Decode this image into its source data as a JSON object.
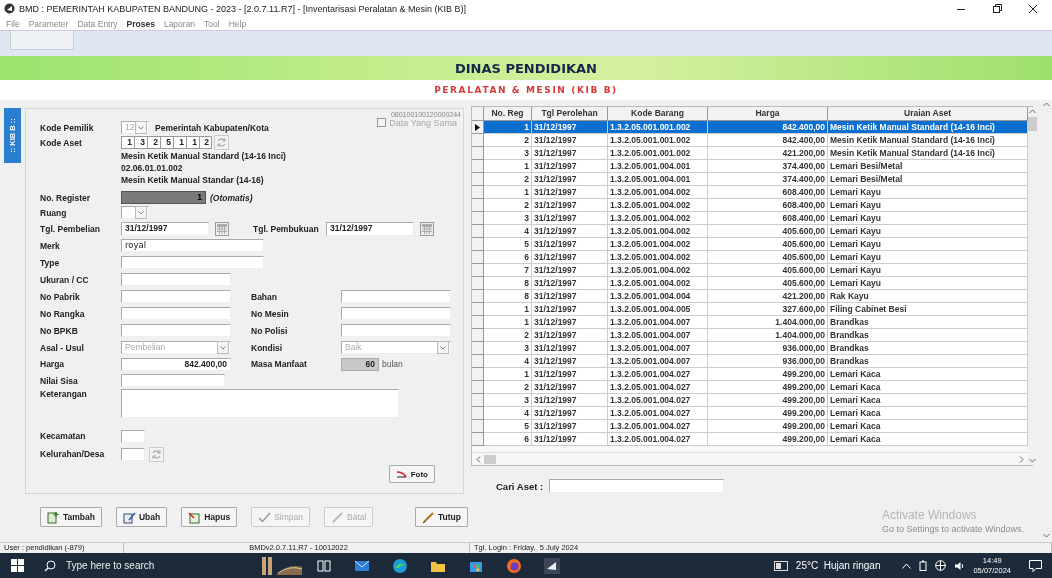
{
  "window": {
    "title": "BMD : PEMERINTAH KABUPATEN BANDUNG - 2023 - [2.0.7.11.R7] - [Inventarisasi Peralatan & Mesin (KIB B)]"
  },
  "menu": [
    {
      "label": "File",
      "highlighted": false
    },
    {
      "label": "Parameter",
      "highlighted": false
    },
    {
      "label": "Data Entry",
      "highlighted": false
    },
    {
      "label": "Proses",
      "highlighted": true
    },
    {
      "label": "Laporan",
      "highlighted": false
    },
    {
      "label": "Tool",
      "highlighted": false
    },
    {
      "label": "Help",
      "highlighted": false
    }
  ],
  "header": {
    "title": "DINAS PENDIDIKAN",
    "subtitle": "PERALATAN & MESIN (KIB B)"
  },
  "side_tab": ":: KIB B ::",
  "form": {
    "record_code": "080100100120000244",
    "same_data": {
      "label": "Data Yang Sama",
      "checked": false,
      "disabled": true
    },
    "owner": {
      "label": "Kode Pemilik",
      "code": "12",
      "name": "Pemerintah Kabupaten/Kota"
    },
    "asset_code": {
      "label": "Kode Aset",
      "segments": [
        "1",
        "3",
        "2",
        "5",
        "1",
        "1",
        "2"
      ],
      "description": [
        "Mesin Ketik Manual Standard (14-16 Inci)",
        "02.06.01.01.002",
        "Mesin Ketik Manual Standar (14-16)"
      ]
    },
    "register": {
      "label": "No. Register",
      "value": "1",
      "note": "(Otomatis)"
    },
    "room": {
      "label": "Ruang"
    },
    "purchase_date": {
      "label": "Tgl. Pembelian",
      "value": "31/12/1997"
    },
    "booking_date": {
      "label": "Tgl. Pembukuan",
      "value": "31/12/1997"
    },
    "merk": {
      "label": "Merk",
      "value": "royal"
    },
    "type": {
      "label": "Type"
    },
    "size": {
      "label": "Ukuran / CC"
    },
    "pairs": [
      {
        "left": "No Pabrik",
        "right": "Bahan"
      },
      {
        "left": "No Rangka",
        "right": "No Mesin"
      },
      {
        "left": "No BPKB",
        "right": "No Polisi"
      }
    ],
    "origin": {
      "label": "Asal - Usul",
      "value": "Pembelian"
    },
    "condition": {
      "label": "Kondisi",
      "value": "Baik"
    },
    "price": {
      "label": "Harga",
      "value": "842.400,00"
    },
    "useful_life": {
      "label": "Masa Manfaat",
      "value": "60",
      "unit": "bulan"
    },
    "residual": {
      "label": "Nilai Sisa"
    },
    "notes": {
      "label": "Keterangan"
    },
    "district": {
      "label": "Kecamatan"
    },
    "village": {
      "label": "Kelurahan/Desa"
    },
    "photo_button": "Foto"
  },
  "buttons": [
    {
      "label": "Tambah",
      "disabled": false
    },
    {
      "label": "Ubah",
      "disabled": false
    },
    {
      "label": "Hapus",
      "disabled": false
    },
    {
      "label": "Simpan",
      "disabled": true
    },
    {
      "label": "Batal",
      "disabled": true
    },
    {
      "label": "Tutup",
      "disabled": false
    }
  ],
  "table": {
    "columns": [
      "No. Reg",
      "Tgl Perolehan",
      "Kode Barang",
      "Harga",
      "Uraian Aset"
    ],
    "rows": [
      {
        "cells": [
          "1",
          "31/12/1997",
          "1.3.2.05.001.001.002",
          "842.400,00",
          "Mesin Ketik Manual Standard (14-16 Inci)"
        ],
        "selected": true
      },
      {
        "cells": [
          "2",
          "31/12/1997",
          "1.3.2.05.001.001.002",
          "842.400,00",
          "Mesin Ketik Manual Standard (14-16 Inci)"
        ],
        "selected": false
      },
      {
        "cells": [
          "3",
          "31/12/1997",
          "1.3.2.05.001.001.002",
          "421.200,00",
          "Mesin Ketik Manual Standard (14-16 Inci)"
        ],
        "selected": false
      },
      {
        "cells": [
          "1",
          "31/12/1997",
          "1.3.2.05.001.004.001",
          "374.400,00",
          "Lemari Besi/Metal"
        ],
        "selected": false
      },
      {
        "cells": [
          "2",
          "31/12/1997",
          "1.3.2.05.001.004.001",
          "374.400,00",
          "Lemari Besi/Metal"
        ],
        "selected": false
      },
      {
        "cells": [
          "1",
          "31/12/1997",
          "1.3.2.05.001.004.002",
          "608.400,00",
          "Lemari Kayu"
        ],
        "selected": false
      },
      {
        "cells": [
          "2",
          "31/12/1997",
          "1.3.2.05.001.004.002",
          "608.400,00",
          "Lemari Kayu"
        ],
        "selected": false
      },
      {
        "cells": [
          "3",
          "31/12/1997",
          "1.3.2.05.001.004.002",
          "608.400,00",
          "Lemari Kayu"
        ],
        "selected": false
      },
      {
        "cells": [
          "4",
          "31/12/1997",
          "1.3.2.05.001.004.002",
          "405.600,00",
          "Lemari Kayu"
        ],
        "selected": false
      },
      {
        "cells": [
          "5",
          "31/12/1997",
          "1.3.2.05.001.004.002",
          "405.600,00",
          "Lemari Kayu"
        ],
        "selected": false
      },
      {
        "cells": [
          "6",
          "31/12/1997",
          "1.3.2.05.001.004.002",
          "405.600,00",
          "Lemari Kayu"
        ],
        "selected": false
      },
      {
        "cells": [
          "7",
          "31/12/1997",
          "1.3.2.05.001.004.002",
          "405.600,00",
          "Lemari Kayu"
        ],
        "selected": false
      },
      {
        "cells": [
          "8",
          "31/12/1997",
          "1.3.2.05.001.004.002",
          "405.600,00",
          "Lemari Kayu"
        ],
        "selected": false
      },
      {
        "cells": [
          "8",
          "31/12/1997",
          "1.3.2.05.001.004.004",
          "421.200,00",
          "Rak Kayu"
        ],
        "selected": false
      },
      {
        "cells": [
          "1",
          "31/12/1997",
          "1.3.2.05.001.004.005",
          "327.600,00",
          "Filing Cabinet Besi"
        ],
        "selected": false
      },
      {
        "cells": [
          "1",
          "31/12/1997",
          "1.3.2.05.001.004.007",
          "1.404.000,00",
          "Brandkas"
        ],
        "selected": false
      },
      {
        "cells": [
          "2",
          "31/12/1997",
          "1.3.2.05.001.004.007",
          "1.404.000,00",
          "Brandkas"
        ],
        "selected": false
      },
      {
        "cells": [
          "3",
          "31/12/1997",
          "1.3.2.05.001.004.007",
          "936.000,00",
          "Brandkas"
        ],
        "selected": false
      },
      {
        "cells": [
          "4",
          "31/12/1997",
          "1.3.2.05.001.004.007",
          "936.000,00",
          "Brandkas"
        ],
        "selected": false
      },
      {
        "cells": [
          "1",
          "31/12/1997",
          "1.3.2.05.001.004.027",
          "499.200,00",
          "Lemari Kaca"
        ],
        "selected": false
      },
      {
        "cells": [
          "2",
          "31/12/1997",
          "1.3.2.05.001.004.027",
          "499.200,00",
          "Lemari Kaca"
        ],
        "selected": false
      },
      {
        "cells": [
          "3",
          "31/12/1997",
          "1.3.2.05.001.004.027",
          "499.200,00",
          "Lemari Kaca"
        ],
        "selected": false
      },
      {
        "cells": [
          "4",
          "31/12/1997",
          "1.3.2.05.001.004.027",
          "499.200,00",
          "Lemari Kaca"
        ],
        "selected": false
      },
      {
        "cells": [
          "5",
          "31/12/1997",
          "1.3.2.05.001.004.027",
          "499.200,00",
          "Lemari Kaca"
        ],
        "selected": false
      },
      {
        "cells": [
          "6",
          "31/12/1997",
          "1.3.2.05.001.004.027",
          "499.200,00",
          "Lemari Kaca"
        ],
        "selected": false
      }
    ]
  },
  "search": {
    "label": "Cari Aset :"
  },
  "activation": {
    "title": "Activate Windows",
    "text": "Go to Settings to activate Windows."
  },
  "status_bar": [
    "User : pendidikan (-879)",
    "BMDv2.0.7.11.R7 - 10012022",
    "Tgl. Login : Friday,  5 July 2024"
  ],
  "taskbar": {
    "search_placeholder": "Type here to search",
    "weather": "25°C  Hujan ringan",
    "time": "14:49",
    "date": "05/07/2024"
  }
}
